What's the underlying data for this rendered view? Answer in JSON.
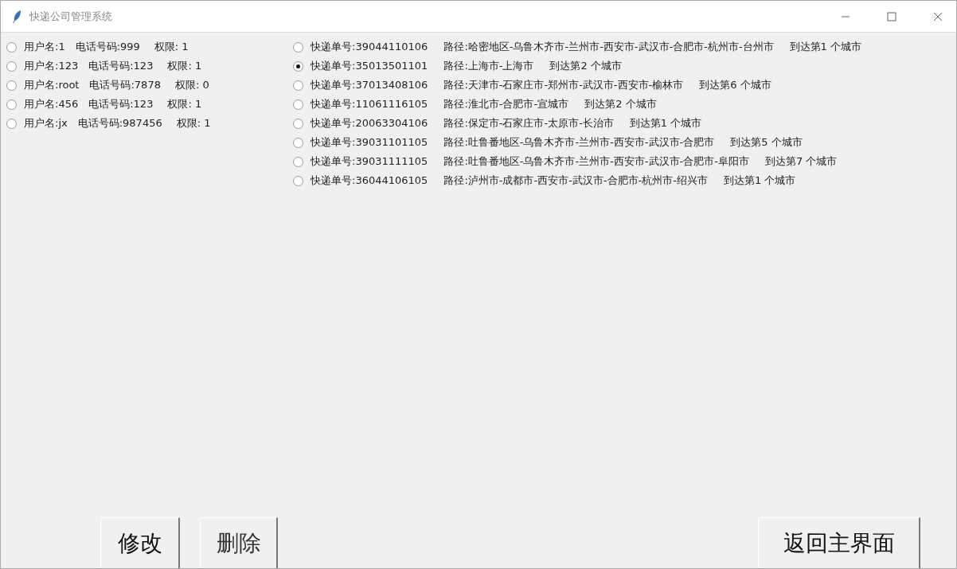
{
  "window": {
    "title": "快递公司管理系统"
  },
  "users": [
    {
      "name": "用户名:1",
      "phone": "电话号码:999",
      "permission": "权限: 1",
      "selected": false
    },
    {
      "name": "用户名:123",
      "phone": "电话号码:123",
      "permission": "权限: 1",
      "selected": false
    },
    {
      "name": "用户名:root",
      "phone": "电话号码:7878",
      "permission": "权限: 0",
      "selected": false
    },
    {
      "name": "用户名:456",
      "phone": "电话号码:123",
      "permission": "权限: 1",
      "selected": false
    },
    {
      "name": "用户名:jx",
      "phone": "电话号码:987456",
      "permission": "权限: 1",
      "selected": false
    }
  ],
  "orders": [
    {
      "number": "快递单号:39044110106",
      "route": "路径:哈密地区-乌鲁木齐市-兰州市-西安市-武汉市-合肥市-杭州市-台州市",
      "progress": "到达第1 个城市",
      "selected": false
    },
    {
      "number": "快递单号:35013501101",
      "route": "路径:上海市-上海市",
      "progress": "到达第2 个城市",
      "selected": true
    },
    {
      "number": "快递单号:37013408106",
      "route": "路径:天津市-石家庄市-郑州市-武汉市-西安市-榆林市",
      "progress": "到达第6 个城市",
      "selected": false
    },
    {
      "number": "快递单号:11061116105",
      "route": "路径:淮北市-合肥市-宣城市",
      "progress": "到达第2 个城市",
      "selected": false
    },
    {
      "number": "快递单号:20063304106",
      "route": "路径:保定市-石家庄市-太原市-长治市",
      "progress": "到达第1 个城市",
      "selected": false
    },
    {
      "number": "快递单号:39031101105",
      "route": "路径:吐鲁番地区-乌鲁木齐市-兰州市-西安市-武汉市-合肥市",
      "progress": "到达第5 个城市",
      "selected": false
    },
    {
      "number": "快递单号:39031111105",
      "route": "路径:吐鲁番地区-乌鲁木齐市-兰州市-西安市-武汉市-合肥市-阜阳市",
      "progress": "到达第7 个城市",
      "selected": false
    },
    {
      "number": "快递单号:36044106105",
      "route": "路径:泸州市-成都市-西安市-武汉市-合肥市-杭州市-绍兴市",
      "progress": "到达第1 个城市",
      "selected": false
    }
  ],
  "buttons": {
    "edit": "修改",
    "delete": "删除",
    "back": "返回主界面"
  }
}
